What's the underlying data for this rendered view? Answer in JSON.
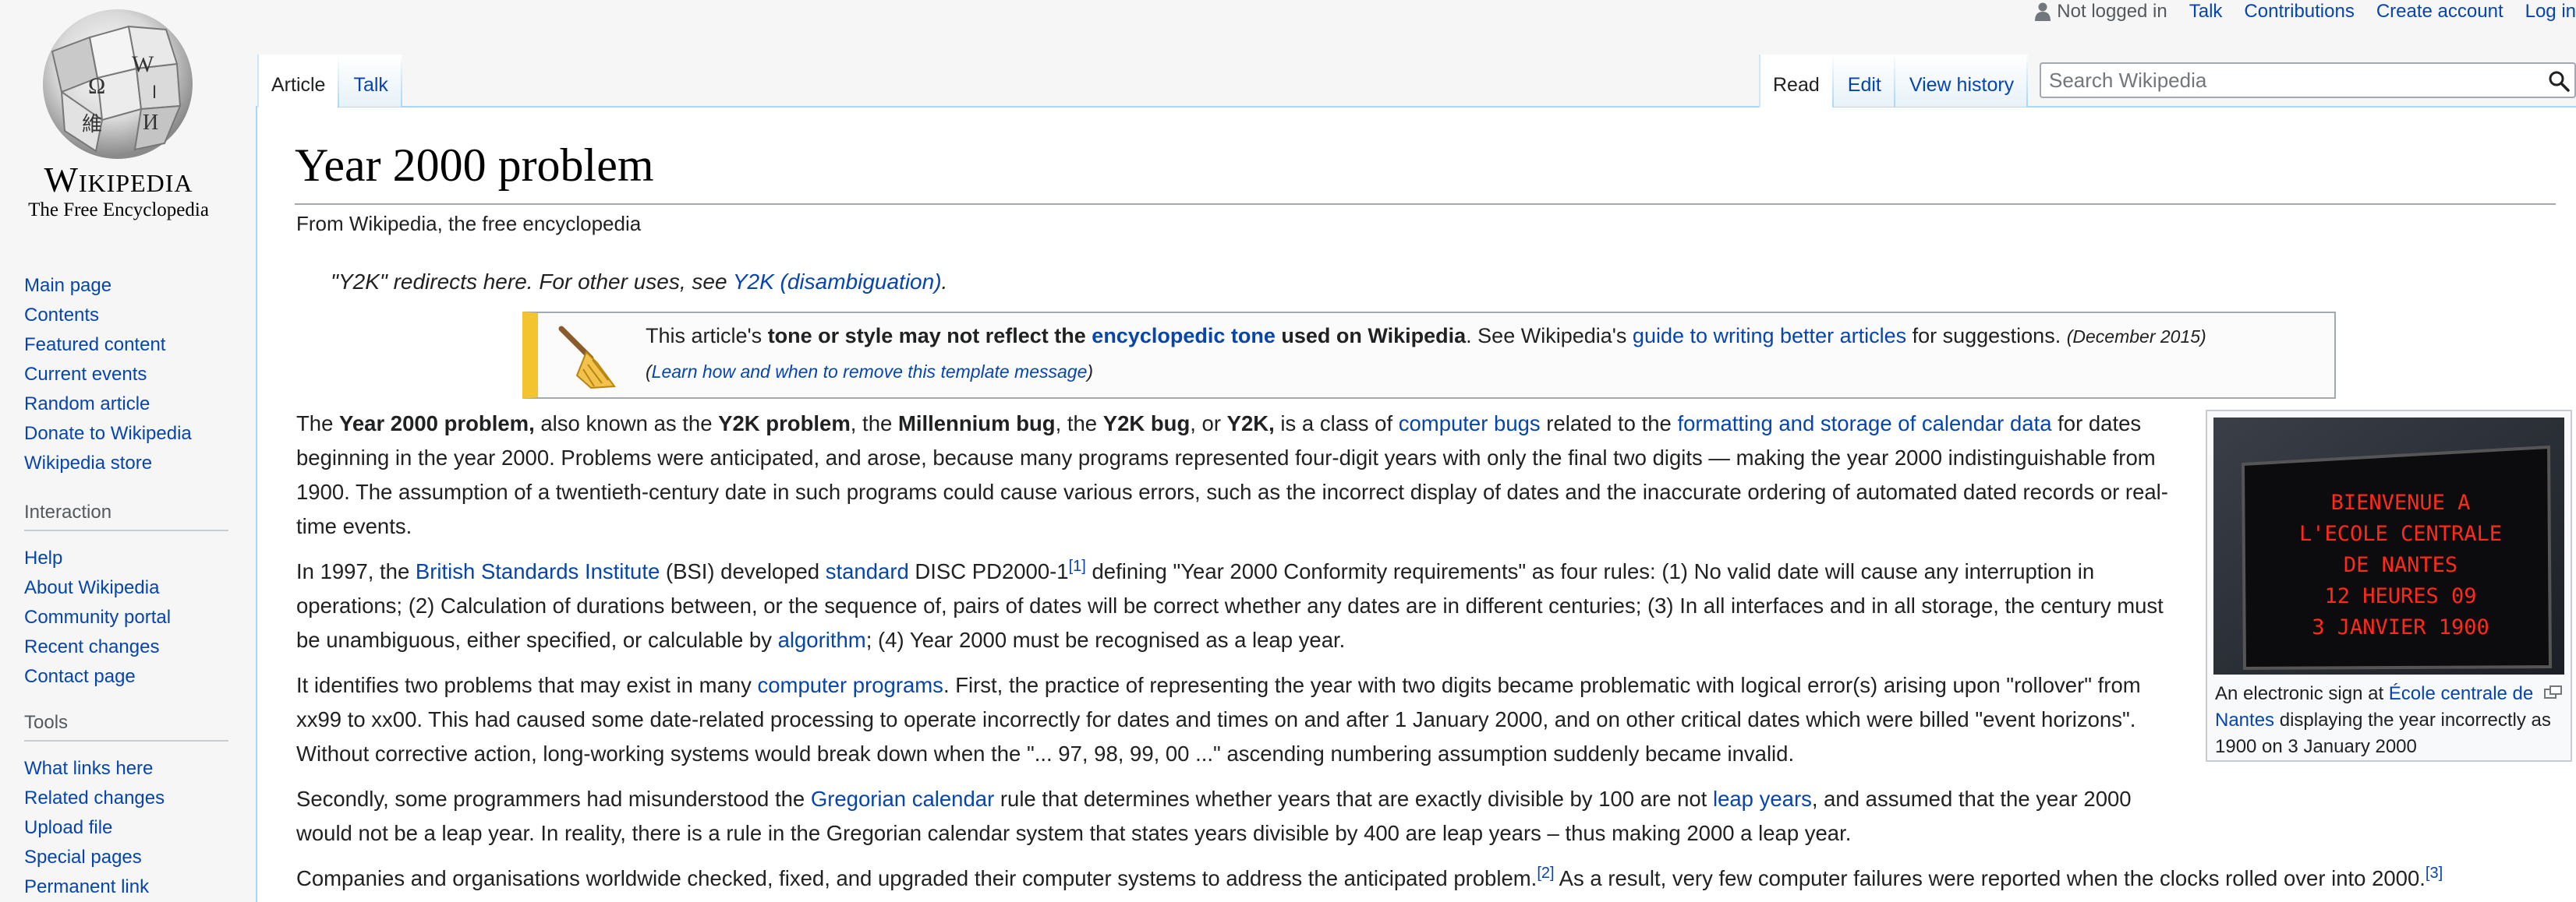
{
  "logo": {
    "wordmark": "Wikipedia",
    "tagline": "The Free Encyclopedia"
  },
  "user_links": {
    "not_logged_in": "Not logged in",
    "talk": "Talk",
    "contributions": "Contributions",
    "create_account": "Create account",
    "log_in": "Log in"
  },
  "left_tabs": [
    {
      "label": "Article",
      "selected": true
    },
    {
      "label": "Talk",
      "selected": false
    }
  ],
  "right_tabs": [
    {
      "label": "Read",
      "selected": true
    },
    {
      "label": "Edit",
      "selected": false
    },
    {
      "label": "View history",
      "selected": false
    }
  ],
  "search": {
    "placeholder": "Search Wikipedia"
  },
  "navigation": {
    "items": [
      "Main page",
      "Contents",
      "Featured content",
      "Current events",
      "Random article",
      "Donate to Wikipedia",
      "Wikipedia store"
    ]
  },
  "interaction": {
    "heading": "Interaction",
    "items": [
      "Help",
      "About Wikipedia",
      "Community portal",
      "Recent changes",
      "Contact page"
    ]
  },
  "tools": {
    "heading": "Tools",
    "items": [
      "What links here",
      "Related changes",
      "Upload file",
      "Special pages",
      "Permanent link"
    ]
  },
  "article": {
    "title": "Year 2000 problem",
    "site_sub": "From Wikipedia, the free encyclopedia",
    "hatnote": {
      "text": "\"Y2K\" redirects here. For other uses, see ",
      "link": "Y2K (disambiguation)",
      "end": "."
    },
    "ambox": {
      "t1": "This article's ",
      "b1": "tone or style may not reflect the ",
      "link1": "encyclopedic tone",
      "b2": " used on Wikipedia",
      "t2": ". See Wikipedia's ",
      "link2": "guide to writing better articles",
      "t3": " for suggestions. ",
      "date": "(December 2015)",
      "remove_link": "Learn how and when to remove this template message",
      "open": "(",
      "close": ")"
    },
    "paragraphs": [
      [
        {
          "t": "The "
        },
        {
          "b": "Year 2000 problem,"
        },
        {
          "t": " also known as the "
        },
        {
          "b": "Y2K problem"
        },
        {
          "t": ", the "
        },
        {
          "b": "Millennium bug"
        },
        {
          "t": ", the "
        },
        {
          "b": "Y2K bug"
        },
        {
          "t": ", or "
        },
        {
          "b": "Y2K,"
        },
        {
          "t": " is a class of "
        },
        {
          "a": "computer bugs"
        },
        {
          "t": " related to the "
        },
        {
          "a": "formatting and storage of calendar data"
        },
        {
          "t": " for dates beginning in the year 2000. Problems were anticipated, and arose, because many programs represented four-digit years with only the final two digits — making the year 2000 indistinguishable from 1900. The assumption of a twentieth-century date in such programs could cause various errors, such as the incorrect display of dates and the inaccurate ordering of automated dated records or real-time events."
        }
      ],
      [
        {
          "t": "In 1997, the "
        },
        {
          "a": "British Standards Institute"
        },
        {
          "t": " (BSI) developed "
        },
        {
          "a": "standard"
        },
        {
          "t": " DISC PD2000-1"
        },
        {
          "sup": "[1]"
        },
        {
          "t": " defining \"Year 2000 Conformity requirements\" as four rules: (1) No valid date will cause any interruption in operations; (2) Calculation of durations between, or the sequence of, pairs of dates will be correct whether any dates are in different centuries; (3) In all interfaces and in all storage, the century must be unambiguous, either specified, or calculable by "
        },
        {
          "a": "algorithm"
        },
        {
          "t": "; (4) Year 2000 must be recognised as a leap year."
        }
      ],
      [
        {
          "t": "It identifies two problems that may exist in many "
        },
        {
          "a": "computer programs"
        },
        {
          "t": ". First, the practice of representing the year with two digits became problematic with logical error(s) arising upon \"rollover\" from xx99 to xx00. This had caused some date-related processing to operate incorrectly for dates and times on and after 1 January 2000, and on other critical dates which were billed \"event horizons\". Without corrective action, long-working systems would break down when the \"... 97, 98, 99, 00 ...\" ascending numbering assumption suddenly became invalid."
        }
      ],
      [
        {
          "t": "Secondly, some programmers had misunderstood the "
        },
        {
          "a": "Gregorian calendar"
        },
        {
          "t": " rule that determines whether years that are exactly divisible by 100 are not "
        },
        {
          "a": "leap years"
        },
        {
          "t": ", and assumed that the year 2000 would not be a leap year. In reality, there is a rule in the Gregorian calendar system that states years divisible by 400 are leap years – thus making 2000 a leap year."
        }
      ],
      [
        {
          "t": "Companies and organisations worldwide checked, fixed, and upgraded their computer systems to address the anticipated problem."
        },
        {
          "sup": "[2]"
        },
        {
          "t": " As a result, very few computer failures were reported when the clocks rolled over into 2000."
        },
        {
          "sup": "[3]"
        }
      ]
    ],
    "thumb": {
      "sign_lines": [
        "BIENVENUE A",
        "L'ECOLE CENTRALE",
        "DE NANTES",
        "12 HEURES 09",
        "3 JANVIER 1900"
      ],
      "caption_pre": "An electronic sign at ",
      "caption_link": "École centrale de Nantes",
      "caption_post": " displaying the year incorrectly as 1900 on 3 January 2000"
    }
  },
  "colors": {
    "link": "#0645ad",
    "ambox_style": "#f4c430",
    "sign_text": "#ff2a1a",
    "tab_border": "#a7d7f9"
  }
}
